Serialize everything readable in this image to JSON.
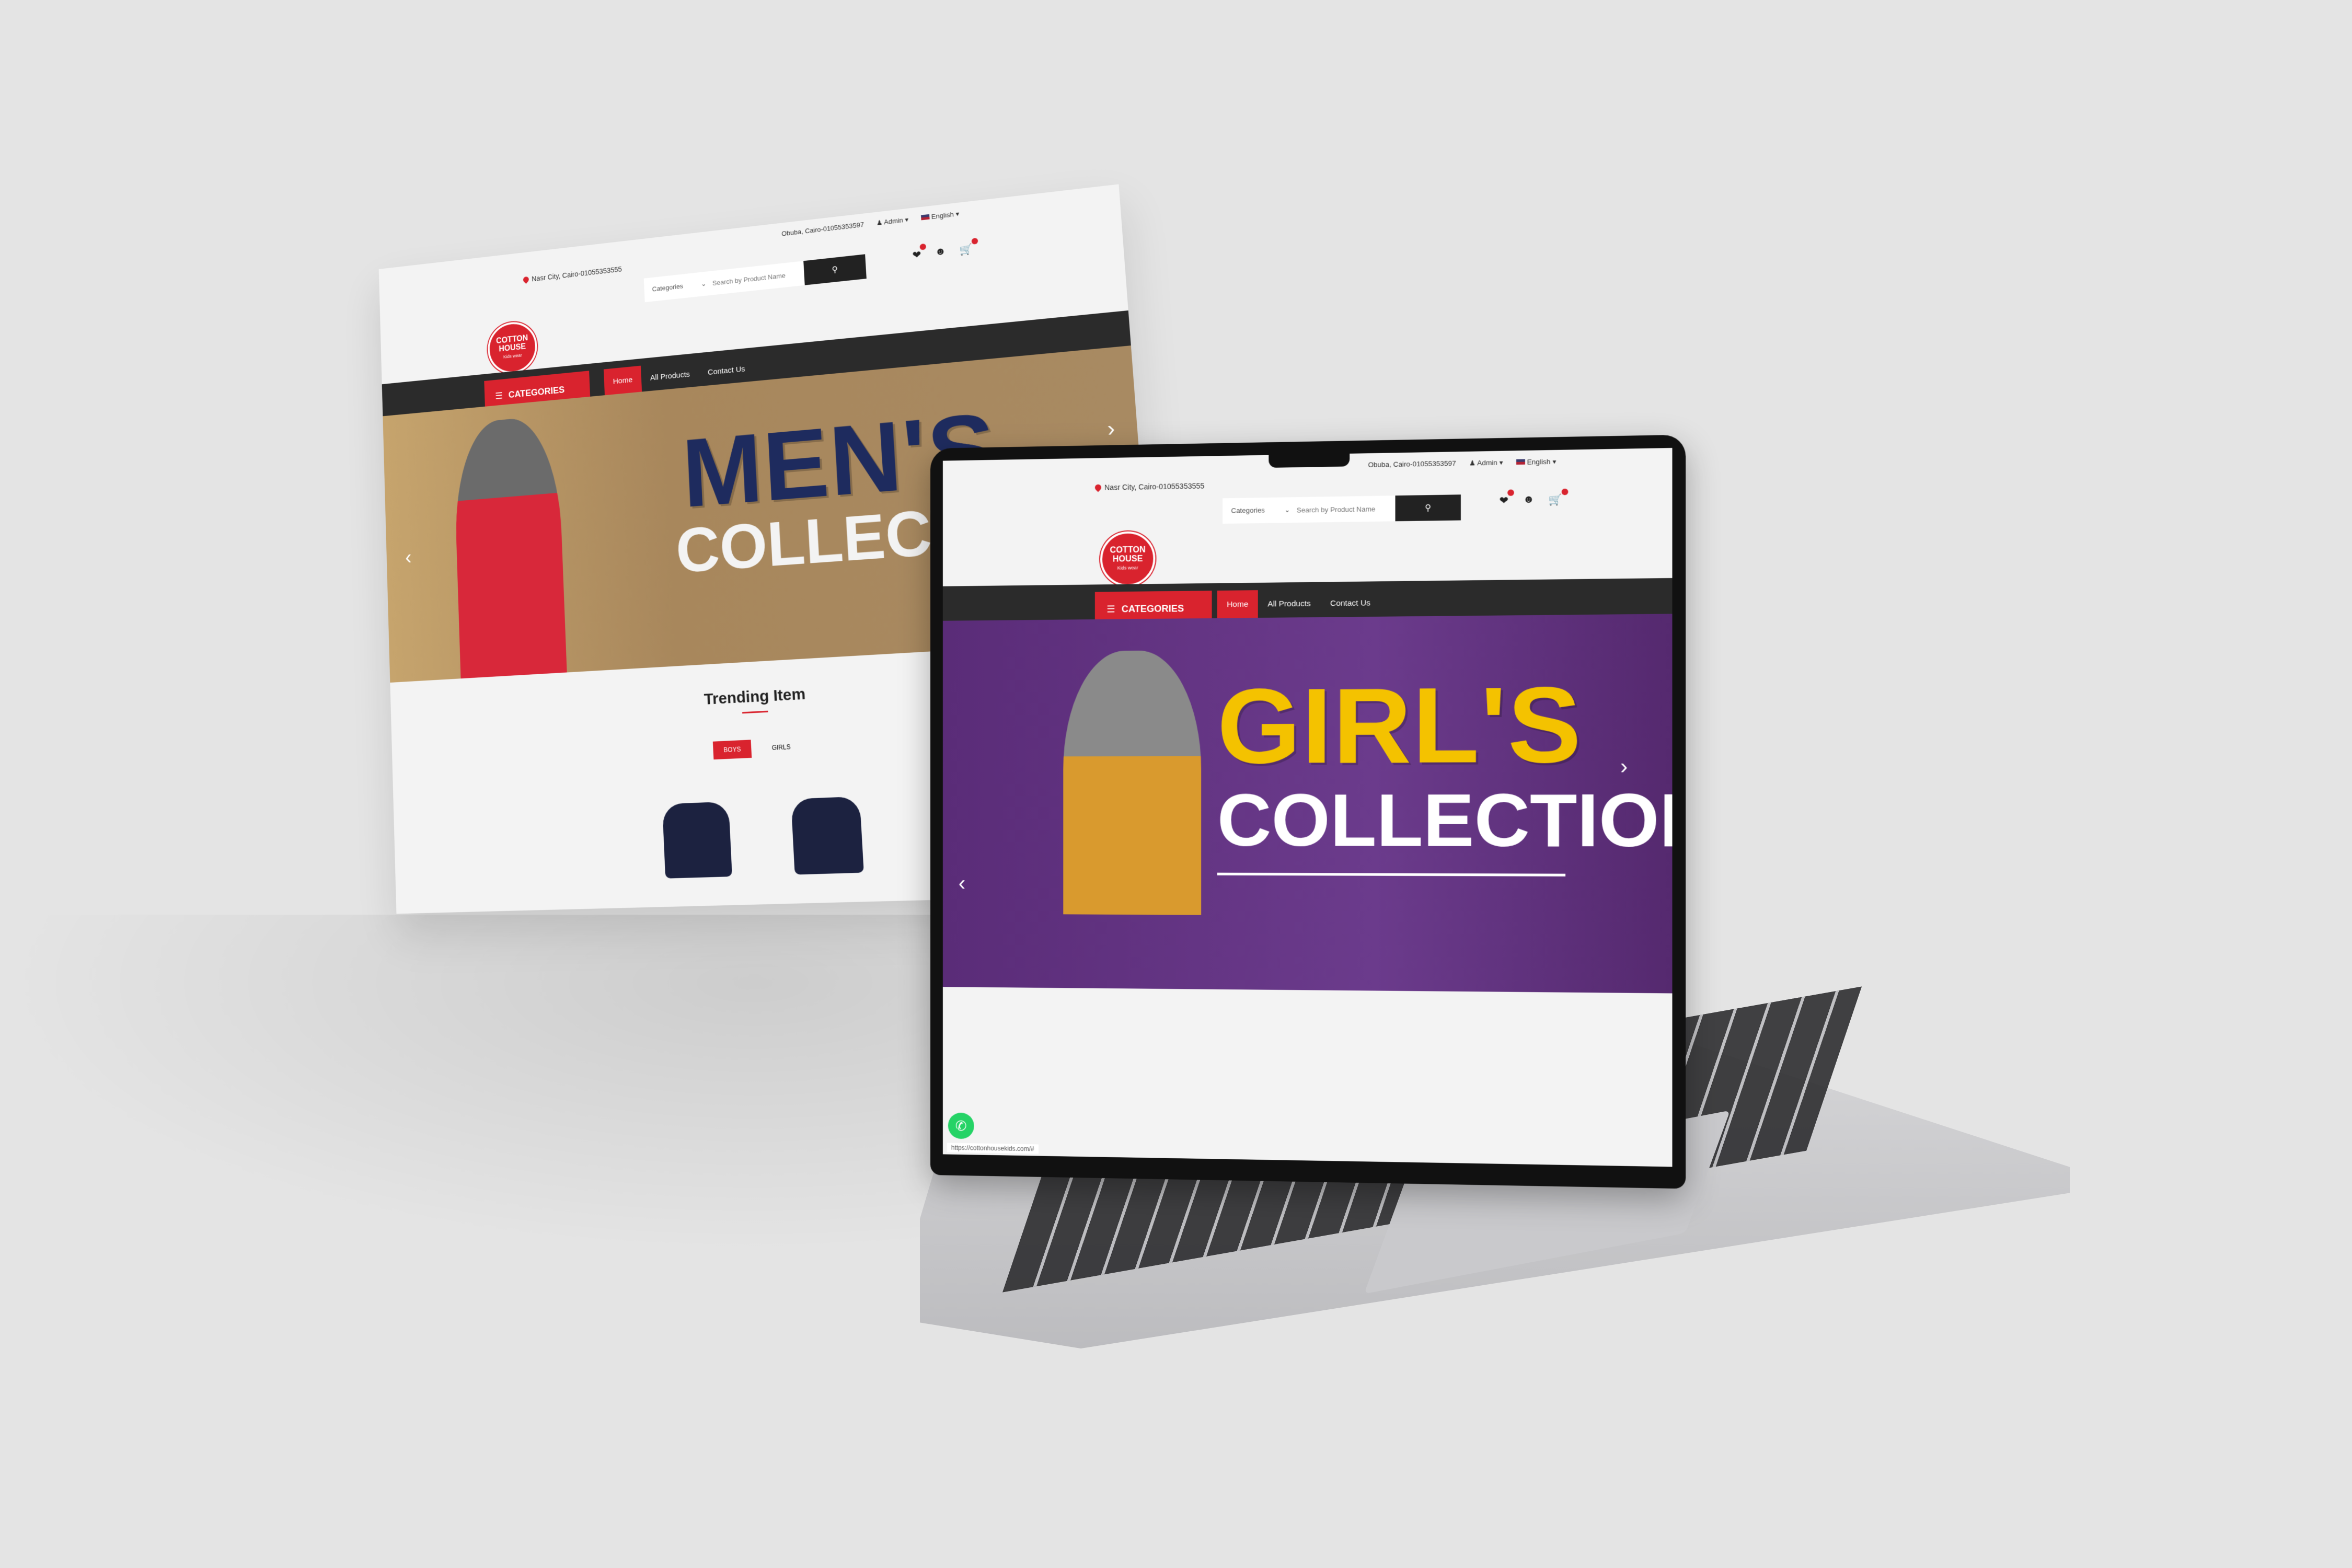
{
  "site": {
    "topbar": {
      "location": "Nasr City, Cairo-01055353555",
      "address_right": "Obuba, Cairo-01055353597",
      "account": "Admin",
      "language": "English"
    },
    "search": {
      "category_label": "Categories",
      "placeholder": "Search by Product Name"
    },
    "logo": {
      "line1": "COTTON",
      "line2": "HOUSE",
      "sub": "Kids wear"
    },
    "nav": {
      "categories_label": "CATEGORIES",
      "links": [
        "Home",
        "All Products",
        "Contact Us"
      ]
    },
    "status_url": "https://cottonhousekids.com/#"
  },
  "floating_page": {
    "hero_title": "MEN'S",
    "hero_subtitle": "COLLECTION",
    "section_title": "Trending Item",
    "tabs": [
      "BOYS",
      "GIRLS"
    ]
  },
  "laptop_page": {
    "hero_title": "GIRL'S",
    "hero_subtitle": "COLLECTION"
  },
  "colors": {
    "brand_red": "#d9232e",
    "nav_dark": "#2b2b2b",
    "men_bg": "#a8875c",
    "girls_bg": "#6b3b8c",
    "girls_title": "#f4c200",
    "men_title": "#1e2b5e"
  },
  "icons": {
    "wishlist": "heart-icon",
    "account": "user-icon",
    "cart": "cart-icon",
    "search": "search-icon",
    "whatsapp": "whatsapp-icon"
  }
}
